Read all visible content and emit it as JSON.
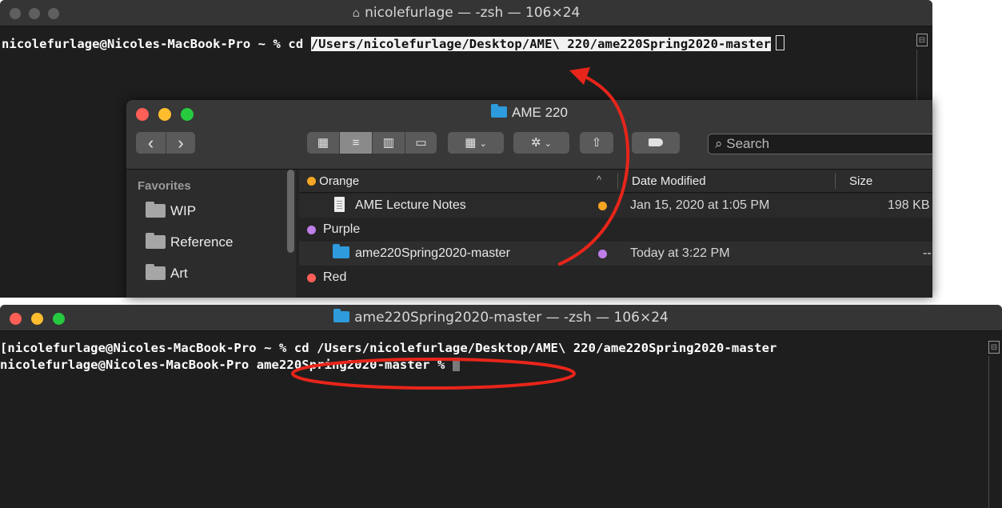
{
  "terminal_top": {
    "title": "nicolefurlage — -zsh — 106×24",
    "title_icon": "house-icon",
    "prompt": "nicolefurlage@Nicoles-MacBook-Pro ~ % cd ",
    "path": "/Users/nicolefurlage/Desktop/AME\\ 220/ame220Spring2020-master"
  },
  "finder": {
    "title": "AME 220",
    "nav": {
      "back": "‹",
      "forward": "›"
    },
    "search_placeholder": "Search",
    "sidebar": {
      "header": "Favorites",
      "items": [
        {
          "label": "WIP"
        },
        {
          "label": "Reference"
        },
        {
          "label": "Art"
        }
      ]
    },
    "columns": {
      "name": "Orange",
      "date": "Date Modified",
      "size": "Size"
    },
    "groups": {
      "orange": {
        "label": "Orange",
        "color": "#f5a623"
      },
      "purple": {
        "label": "Purple",
        "color": "#c07ee8"
      },
      "red": {
        "label": "Red",
        "color": "#ff5f56"
      }
    },
    "rows": [
      {
        "name": "AME Lecture Notes",
        "tag_color": "#f5a623",
        "date": "Jan 15, 2020 at 1:05 PM",
        "size": "198 KB"
      },
      {
        "name": "ame220Spring2020-master",
        "tag_color": "#c07ee8",
        "date": "Today at 3:22 PM",
        "size": "--"
      }
    ]
  },
  "terminal_bottom": {
    "title": "ame220Spring2020-master — -zsh — 106×24",
    "line1": "[nicolefurlage@Nicoles-MacBook-Pro ~ % cd /Users/nicolefurlage/Desktop/AME\\ 220/ame220Spring2020-master",
    "line2_prefix": "nicolefurlage@Nicoles-MacBook-Pro ",
    "line2_dir": "ame220Spring2020-master %"
  },
  "colors": {
    "traffic_red": "#ff5f56",
    "traffic_yellow": "#ffbd2e",
    "traffic_green": "#27c93f",
    "traffic_inactive": "#5f5f5f",
    "annotation_red": "#e8251a"
  }
}
